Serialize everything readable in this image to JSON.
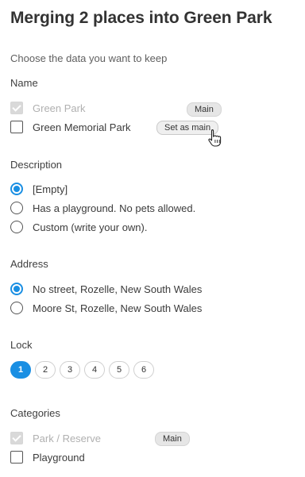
{
  "title": "Merging 2 places into Green Park",
  "subtitle": "Choose the data you want to keep",
  "name": {
    "label": "Name",
    "options": [
      {
        "text": "Green Park",
        "checked": true,
        "disabled": true,
        "badge": "Main"
      },
      {
        "text": "Green Memorial Park",
        "checked": false,
        "disabled": false,
        "action": "Set as main"
      }
    ]
  },
  "description": {
    "label": "Description",
    "options": [
      {
        "text": "[Empty]",
        "selected": true
      },
      {
        "text": "Has a playground. No pets allowed.",
        "selected": false
      },
      {
        "text": "Custom (write your own).",
        "selected": false
      }
    ]
  },
  "address": {
    "label": "Address",
    "options": [
      {
        "text": "No street, Rozelle, New South Wales",
        "selected": true
      },
      {
        "text": "Moore St, Rozelle, New South Wales",
        "selected": false
      }
    ]
  },
  "lock": {
    "label": "Lock",
    "levels": [
      "1",
      "2",
      "3",
      "4",
      "5",
      "6"
    ],
    "selected": "1"
  },
  "categories": {
    "label": "Categories",
    "options": [
      {
        "text": "Park / Reserve",
        "checked": true,
        "disabled": true,
        "badge": "Main"
      },
      {
        "text": "Playground",
        "checked": false,
        "disabled": false
      }
    ]
  },
  "colors": {
    "accent": "#1a8fe3",
    "disabled_text": "#b0b0b0"
  }
}
